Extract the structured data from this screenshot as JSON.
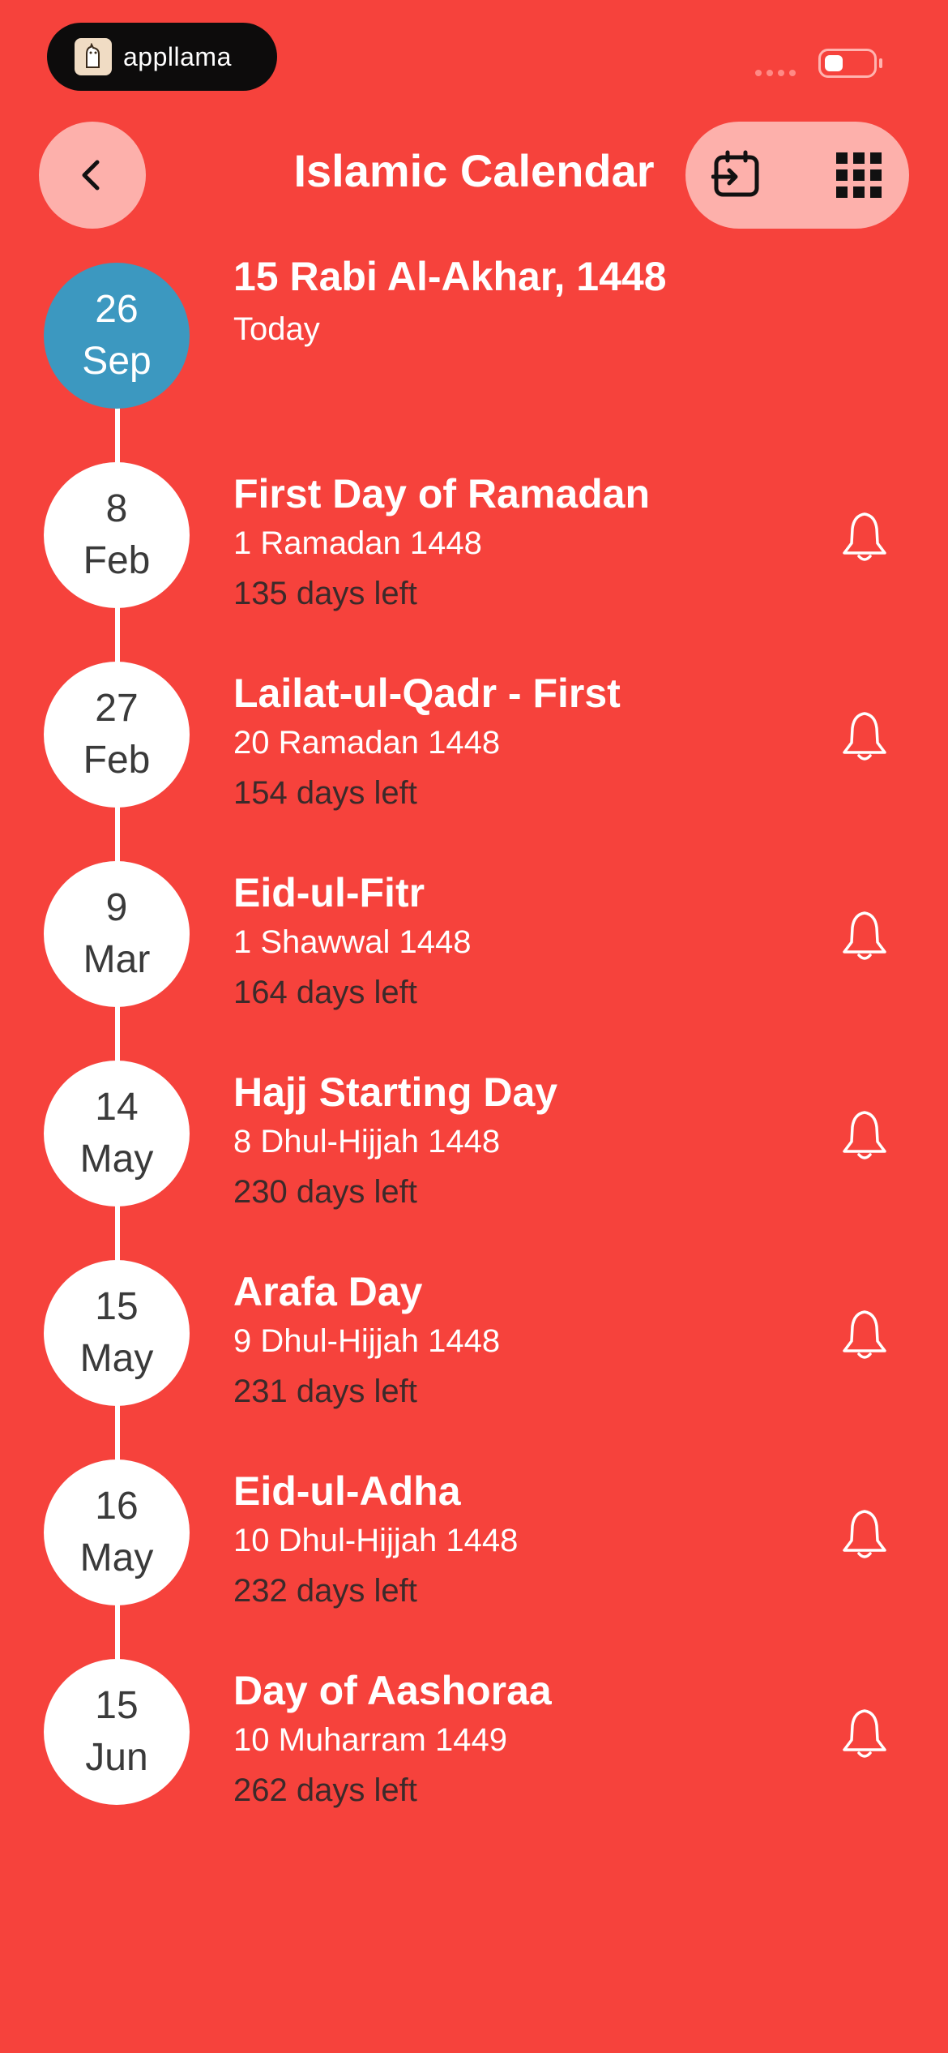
{
  "status_bar": {
    "brand_text": "appllama",
    "logo_icon": "llama-icon",
    "battery_icon": "battery-icon"
  },
  "header": {
    "title": "Islamic Calendar",
    "back_icon": "chevron-left-icon",
    "convert_icon": "calendar-convert-icon",
    "menu_icon": "grid-icon"
  },
  "colors": {
    "background": "#f6423c",
    "today_circle": "#3c98c0",
    "pill": "#fdb0ab"
  },
  "today": {
    "day": "26",
    "month": "Sep",
    "hijri": "15 Rabi Al-Akhar, 1448",
    "label": "Today"
  },
  "events": [
    {
      "day": "8",
      "month": "Feb",
      "title": "First Day of Ramadan",
      "hijri": "1 Ramadan 1448",
      "left": "135 days left"
    },
    {
      "day": "27",
      "month": "Feb",
      "title": "Lailat-ul-Qadr - First",
      "hijri": "20 Ramadan 1448",
      "left": "154 days left"
    },
    {
      "day": "9",
      "month": "Mar",
      "title": "Eid-ul-Fitr",
      "hijri": "1 Shawwal 1448",
      "left": "164 days left"
    },
    {
      "day": "14",
      "month": "May",
      "title": "Hajj Starting Day",
      "hijri": "8 Dhul-Hijjah 1448",
      "left": "230 days left"
    },
    {
      "day": "15",
      "month": "May",
      "title": "Arafa Day",
      "hijri": "9 Dhul-Hijjah 1448",
      "left": "231 days left"
    },
    {
      "day": "16",
      "month": "May",
      "title": "Eid-ul-Adha",
      "hijri": "10 Dhul-Hijjah 1448",
      "left": "232 days left"
    },
    {
      "day": "15",
      "month": "Jun",
      "title": "Day of Aashoraa",
      "hijri": "10 Muharram 1449",
      "left": "262 days left"
    }
  ]
}
